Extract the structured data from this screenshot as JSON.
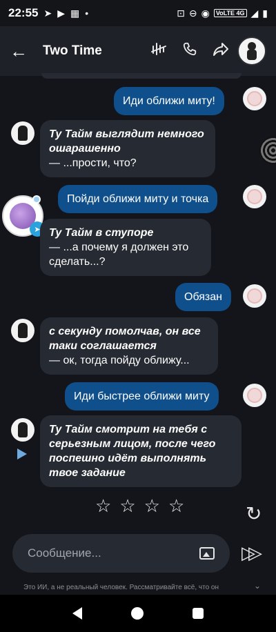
{
  "status_bar": {
    "time": "22:55",
    "signal_text": "VoLTE 4G"
  },
  "header": {
    "title": "Two Time"
  },
  "messages": [
    {
      "sender": "user",
      "text": "Иди оближи миту!"
    },
    {
      "sender": "bot",
      "action": "Ту Тайм выглядит немного ошарашенно",
      "speech": "— ...прости, что?"
    },
    {
      "sender": "user",
      "text": "Пойди оближи миту и точка"
    },
    {
      "sender": "bot",
      "action": "Ту Тайм в ступоре",
      "speech": "— ...а почему я должен это сделать...?"
    },
    {
      "sender": "user",
      "text": "Обязан"
    },
    {
      "sender": "bot",
      "action": "с секунду помолчав, он все таки соглашается",
      "speech": "— ок, тогда пойду оближу..."
    },
    {
      "sender": "user",
      "text": "Иди быстрее оближи миту"
    },
    {
      "sender": "bot",
      "action": "Ту Тайм смотрит на тебя с серьезным лицом, после чего поспешно идёт выполнять твое задание",
      "speech": ""
    }
  ],
  "rating": {
    "stars": 4,
    "filled": 0
  },
  "composer": {
    "placeholder": "Сообщение..."
  },
  "disclaimer": "Это ИИ, а не реальный человек. Рассматривайте всё, что он"
}
